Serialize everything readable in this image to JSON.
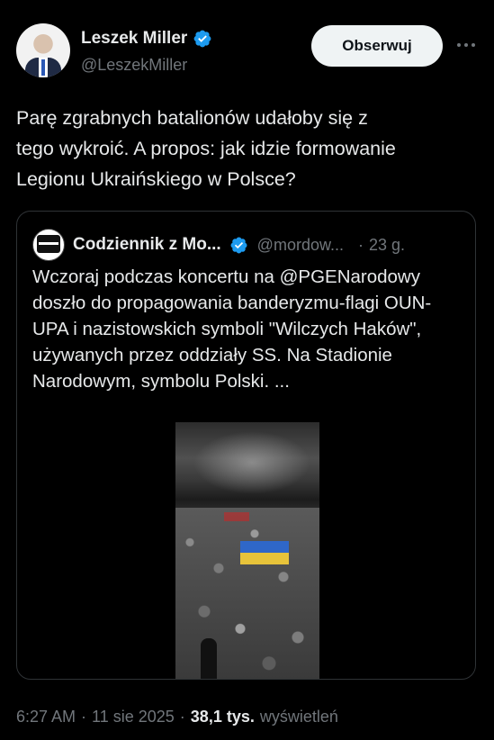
{
  "author": {
    "display_name": "Leszek Miller",
    "handle": "@LeszekMiller",
    "verified_icon": "verified-badge-icon",
    "follow_label": "Obserwuj",
    "more_icon": "more-horizontal-icon"
  },
  "tweet": {
    "text": "Parę zgrabnych batalionów udałoby się z\ntego wykroić. A propos: jak idzie formowanie\nLegionu Ukraińskiego w Polsce?"
  },
  "quote": {
    "display_name": "Codziennik z Mo...",
    "handle": "@mordow...",
    "separator": "·",
    "time": "23 g.",
    "text": "Wczoraj podczas koncertu na @PGENarodowy doszło do propagowania banderyzmu-flagi OUN-UPA i nazistowskich symboli \"Wilczych Haków\", używanych przez oddziały SS. Na Stadionie Narodowym, symbolu Polski. ...",
    "media_icon": "video-thumbnail"
  },
  "meta": {
    "time": "6:27 AM",
    "dot1": "·",
    "date": "11 sie 2025",
    "dot2": "·",
    "views_count": "38,1 tys.",
    "views_label": "wyświetleń"
  },
  "colors": {
    "background": "#000000",
    "text_primary": "#e7e9ea",
    "text_secondary": "#71767b",
    "verified_blue": "#1d9bf0",
    "border": "#2f3336",
    "follow_bg": "#eff3f4"
  }
}
